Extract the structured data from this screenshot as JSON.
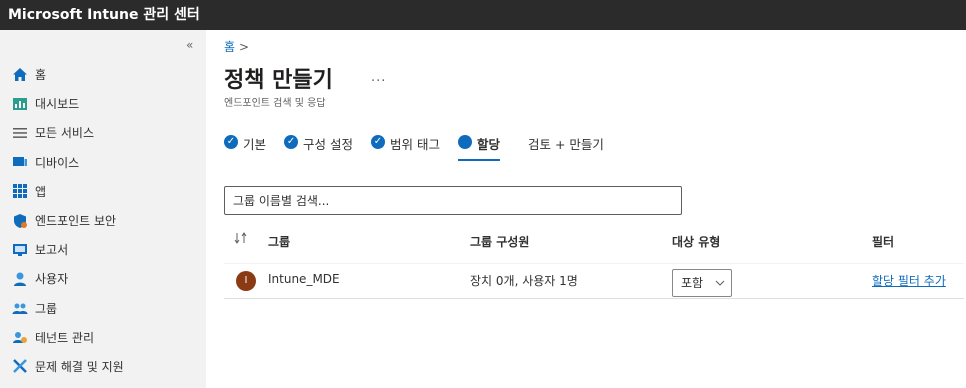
{
  "app_title": "Microsoft Intune 관리 센터",
  "sidebar": {
    "collapse_glyph": "«",
    "items": [
      {
        "label": "홈",
        "icon": "home-icon"
      },
      {
        "label": "대시보드",
        "icon": "dashboard-icon"
      },
      {
        "label": "모든 서비스",
        "icon": "list-icon"
      },
      {
        "label": "디바이스",
        "icon": "devices-icon"
      },
      {
        "label": "앱",
        "icon": "apps-icon"
      },
      {
        "label": "엔드포인트 보안",
        "icon": "shield-icon"
      },
      {
        "label": "보고서",
        "icon": "reports-icon"
      },
      {
        "label": "사용자",
        "icon": "user-icon"
      },
      {
        "label": "그룹",
        "icon": "group-icon"
      },
      {
        "label": "테넌트 관리",
        "icon": "tenant-icon"
      },
      {
        "label": "문제 해결 및 지원",
        "icon": "tools-icon"
      }
    ]
  },
  "breadcrumb": {
    "home": "홈",
    "separator": ">"
  },
  "page": {
    "title": "정책 만들기",
    "more": "...",
    "subtitle": "엔드포인트 검색 및 응답"
  },
  "wizard_tabs": [
    {
      "label": "기본",
      "state": "done"
    },
    {
      "label": "구성 설정",
      "state": "done"
    },
    {
      "label": "범위 태그",
      "state": "done"
    },
    {
      "label": "할당",
      "state": "active"
    },
    {
      "label": "검토 + 만들기",
      "state": "pending"
    }
  ],
  "search": {
    "placeholder": "그룹 이름별 검색..."
  },
  "table": {
    "headers": {
      "group": "그룹",
      "members": "그룹 구성원",
      "target_type": "대상 유형",
      "filter": "필터"
    },
    "rows": [
      {
        "avatar_letter": "I",
        "group": "Intune_MDE",
        "members": "장치 0개, 사용자 1명",
        "target_type": "포함",
        "filter_link": "할당 필터 추가"
      }
    ]
  },
  "colors": {
    "accent": "#0f6cbd",
    "topbar": "#2b2b2b",
    "sidebar": "#f2f2f2",
    "avatar": "#8a3b14"
  }
}
